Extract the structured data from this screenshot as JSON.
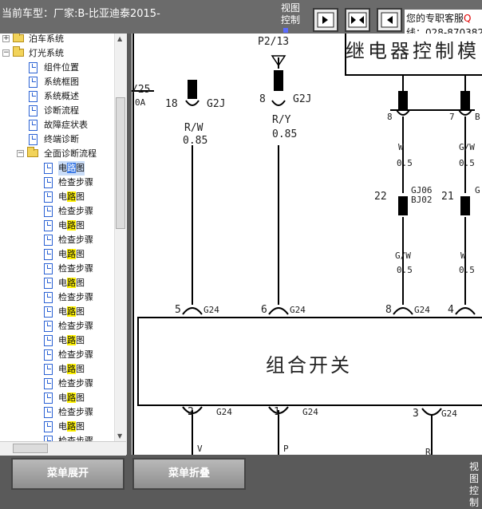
{
  "header": {
    "car_label": "当前车型：厂家:B-比亚迪泰2015-",
    "view_control_line1": "视图",
    "view_control_line2": "控制",
    "nav_buttons": [
      "next-icon",
      "collapse-split-icon",
      "prev-icon"
    ]
  },
  "service": {
    "line1": "您的专职客服",
    "line1_accent": "Q",
    "line2": "线：028-870382"
  },
  "tree": {
    "nodes": [
      {
        "label": "泊车系统"
      },
      {
        "label": "灯光系统"
      },
      {
        "label": "组件位置"
      },
      {
        "label": "系统框图"
      },
      {
        "label": "系统概述"
      },
      {
        "label": "诊断流程"
      },
      {
        "label": "故障症状表"
      },
      {
        "label": "终端诊断"
      },
      {
        "label": "全面诊断流程"
      }
    ],
    "leaf_a": [
      "电",
      "路",
      "图"
    ],
    "leaf_b": "检查步骤"
  },
  "diagram": {
    "title": "继电器控制模",
    "component": "组合开关",
    "labels": {
      "p2_13": "P2/13",
      "frag_25": "/25",
      "frag_0a": "0A",
      "pin18": "18",
      "g2j_a": "G2J",
      "pin8": "8",
      "g2j_b": "G2J",
      "rw": "R/W",
      "w085": "0.85",
      "ry": "R/Y",
      "y085": "0.85",
      "p8": "8",
      "p7": "7",
      "b": "B",
      "w": "W",
      "w05": "0.5",
      "gw": "G/W",
      "gw05": "0.5",
      "pin22": "22",
      "gj06": "GJ06",
      "bj02": "BJ02",
      "pin21": "21",
      "g_": "G",
      "gw2": "G/W",
      "gw2_05": "0.5",
      "w2": "W",
      "w2_05": "0.5",
      "b5": "5",
      "g24_a": "G24",
      "b6": "6",
      "g24_b": "G24",
      "b8": "8",
      "g24_c": "G24",
      "b4": "4",
      "c2": "2",
      "g24_d": "G24",
      "c1": "1",
      "g24_e": "G24",
      "c3": "3",
      "g24_f": "G24",
      "v": "V",
      "p": "P",
      "r": "R"
    }
  },
  "footer": {
    "expand_label": "菜单展开",
    "collapse_label": "菜单折叠",
    "view_control_line1": "视图",
    "view_control_line2": "控制"
  },
  "colors": {
    "highlight": "#fff200",
    "selection": "#3d7be6",
    "accent_red": "#e00000"
  }
}
